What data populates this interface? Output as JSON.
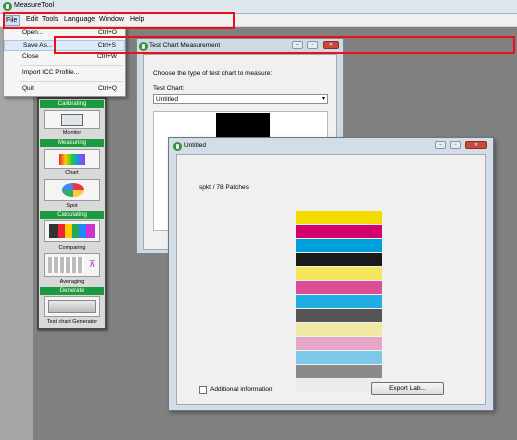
{
  "app": {
    "title": "MeasureTool"
  },
  "menubar": {
    "items": [
      "File",
      "Edit",
      "Tools",
      "Language",
      "Window",
      "Help"
    ]
  },
  "file_menu": {
    "items": [
      {
        "label": "Open...",
        "shortcut": "Ctrl+O"
      },
      {
        "label": "Save As...",
        "shortcut": "Ctrl+S"
      },
      {
        "label": "Close",
        "shortcut": "Ctrl+W"
      },
      {
        "label": "Import ICC Profile...",
        "shortcut": ""
      },
      {
        "label": "Quit",
        "shortcut": "Ctrl+Q"
      }
    ],
    "highlighted": "Save As..."
  },
  "toolbox": {
    "sections": [
      "Calibrating",
      "Measuring",
      "Calculating",
      "Generate"
    ],
    "labels": [
      "Monitor",
      "Chart",
      "Spot",
      "Comparing",
      "Averaging",
      "Test chart Generator"
    ]
  },
  "test_chart_window": {
    "title": "Test Chart Measurement",
    "prompt": "Choose the type of test chart to measure:",
    "field_label": "Test Chart:",
    "selected": "Untitled"
  },
  "untitled_window": {
    "title": "Untitled",
    "info": "spkt / 78 Patches",
    "checkbox_label": "Additional information",
    "checkbox_checked": false,
    "export_button": "Export Lab..."
  },
  "swatch_colors": [
    "#f2dc00",
    "#d3006e",
    "#00a0df",
    "#1a1a1a",
    "#f4e65a",
    "#dd4d95",
    "#21aee3",
    "#555555",
    "#efe9a4",
    "#e6a6c8",
    "#7cc8e8",
    "#8a8a8a",
    "#ececec"
  ],
  "colors": {
    "annotation": "#e8101a",
    "toolbox_header": "#1c9b3e"
  }
}
